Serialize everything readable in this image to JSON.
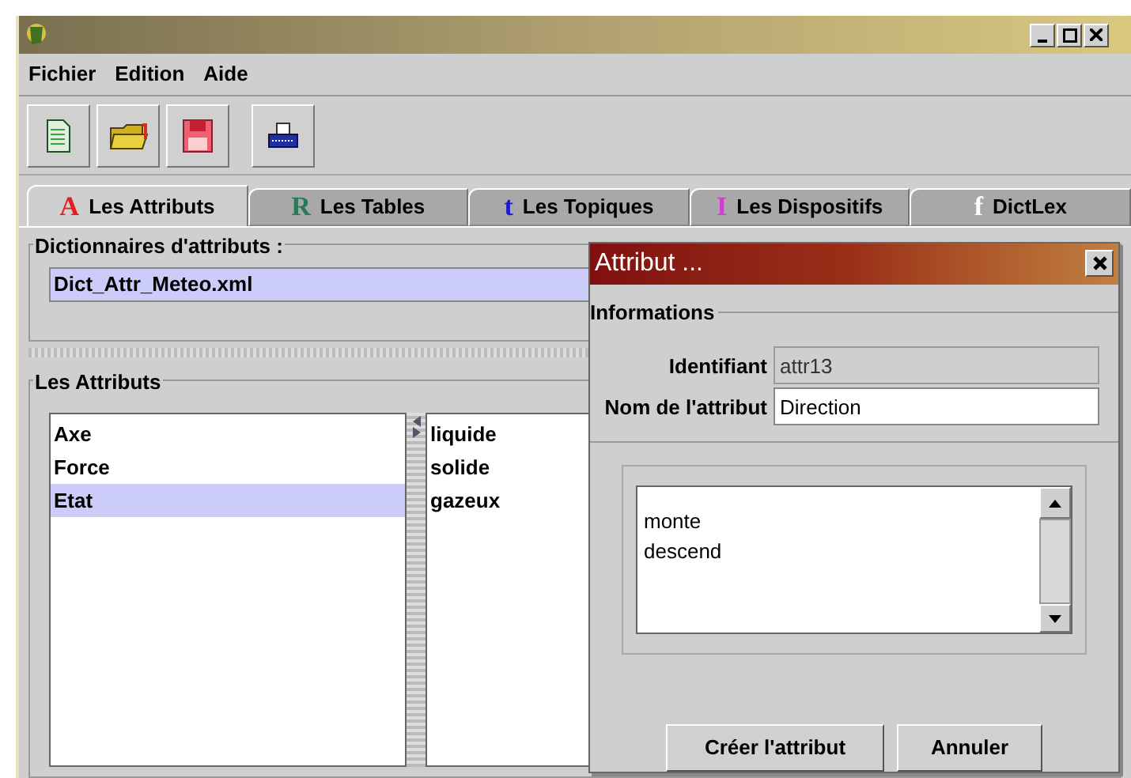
{
  "menu": [
    "Fichier",
    "Edition",
    "Aide"
  ],
  "toolbar": [
    {
      "kind": "new"
    },
    {
      "kind": "open"
    },
    {
      "kind": "save"
    },
    {
      "kind": "print"
    }
  ],
  "tabs": [
    {
      "glyph": "A",
      "color": "#e02020",
      "label": "Les Attributs",
      "selected": true
    },
    {
      "glyph": "R",
      "color": "#2a7a5a",
      "label": "Les Tables",
      "selected": false
    },
    {
      "glyph": "t",
      "color": "#1a1ad0",
      "label": "Les Topiques",
      "selected": false
    },
    {
      "glyph": "I",
      "color": "#d040d0",
      "label": "Les Dispositifs",
      "selected": false
    },
    {
      "glyph": "f",
      "color": "#ffffff",
      "label": "DictLex",
      "selected": false
    }
  ],
  "dictionaries": {
    "title": "Dictionnaires d'attributs :",
    "value": "Dict_Attr_Meteo.xml"
  },
  "attributes": {
    "title": "Les Attributs",
    "items": [
      {
        "label": "Axe",
        "selected": false
      },
      {
        "label": "Force",
        "selected": false
      },
      {
        "label": "Etat",
        "selected": true
      }
    ],
    "values": [
      "liquide",
      "solide",
      "gazeux"
    ]
  },
  "dialog": {
    "title": "Attribut ...",
    "section": "Informations",
    "id_label": "Identifiant",
    "id_value": "attr13",
    "name_label": "Nom de l'attribut",
    "name_value": "Direction",
    "values": "monte\ndescend",
    "buttons": [
      "Créer l'attribut",
      "Annuler"
    ]
  }
}
